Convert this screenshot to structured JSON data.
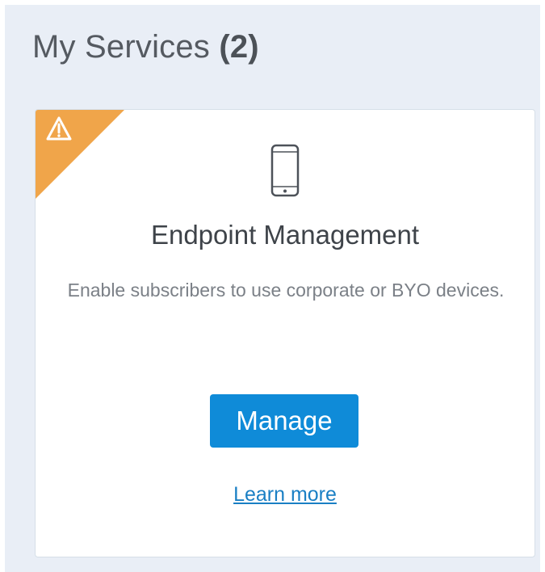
{
  "section": {
    "title": "My Services",
    "count": "(2)"
  },
  "service_card": {
    "warning_icon": "warning-triangle-icon",
    "warning_color": "#f0a54a",
    "device_icon": "mobile-phone-icon",
    "title": "Endpoint Management",
    "description": "Enable subscribers to use corporate or BYO devices.",
    "manage_label": "Manage",
    "learn_more_label": "Learn more"
  },
  "colors": {
    "panel_background": "#e9eef6",
    "primary_button": "#0f8bd8",
    "link": "#1a7fc4"
  }
}
